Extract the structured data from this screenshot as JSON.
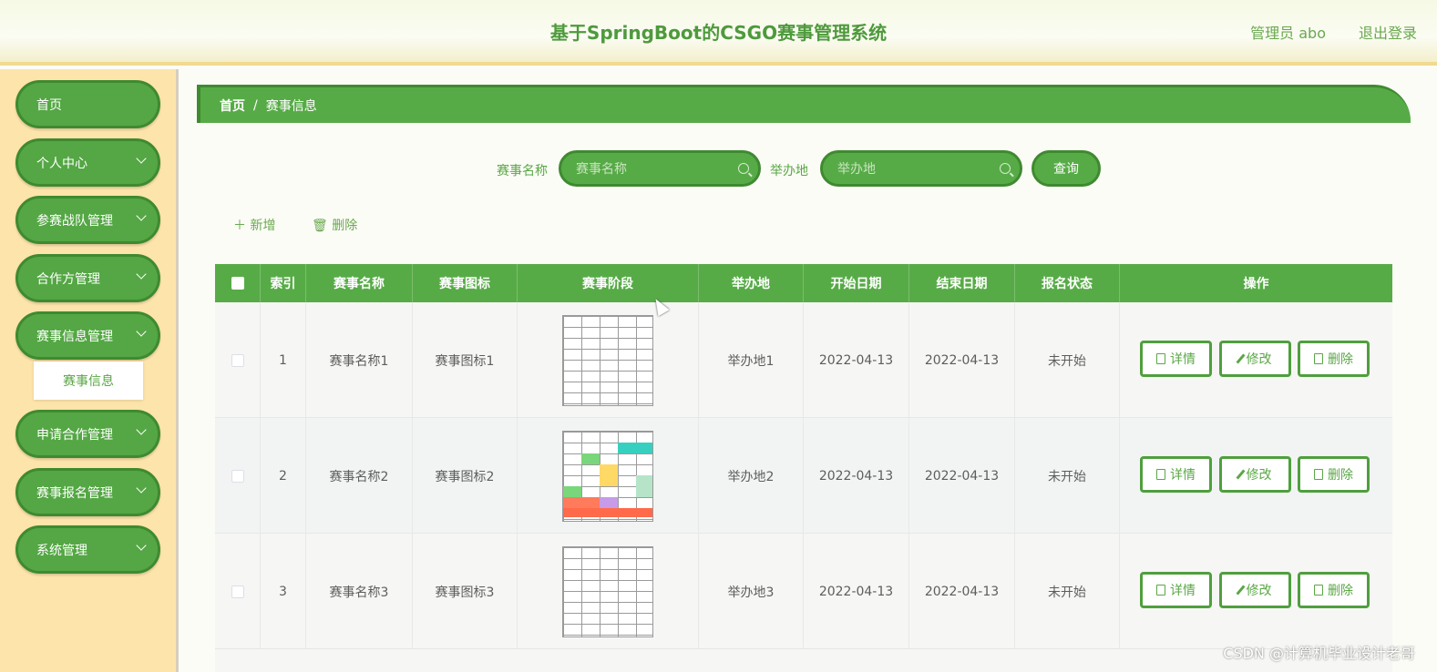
{
  "header": {
    "title": "基于SpringBoot的CSGO赛事管理系统",
    "user": "管理员 abo",
    "logout": "退出登录"
  },
  "sidebar": {
    "items": [
      {
        "label": "首页",
        "has_children": false
      },
      {
        "label": "个人中心",
        "has_children": true
      },
      {
        "label": "参赛战队管理",
        "has_children": true
      },
      {
        "label": "合作方管理",
        "has_children": true
      },
      {
        "label": "赛事信息管理",
        "has_children": true
      },
      {
        "label": "申请合作管理",
        "has_children": true
      },
      {
        "label": "赛事报名管理",
        "has_children": true
      },
      {
        "label": "系统管理",
        "has_children": true
      }
    ],
    "active_submenu": "赛事信息"
  },
  "breadcrumb": {
    "home": "首页",
    "separator": "/",
    "current": "赛事信息"
  },
  "search": {
    "name_label": "赛事名称",
    "name_placeholder": "赛事名称",
    "location_label": "举办地",
    "location_placeholder": "举办地",
    "query_button": "查询"
  },
  "actions": {
    "add": "新增",
    "delete": "删除"
  },
  "table": {
    "columns": [
      "",
      "索引",
      "赛事名称",
      "赛事图标",
      "赛事阶段",
      "举办地",
      "开始日期",
      "结束日期",
      "报名状态",
      "操作"
    ],
    "rows": [
      {
        "index": "1",
        "name": "赛事名称1",
        "icon": "赛事图标1",
        "location": "举办地1",
        "start": "2022-04-13",
        "end": "2022-04-13",
        "status": "未开始"
      },
      {
        "index": "2",
        "name": "赛事名称2",
        "icon": "赛事图标2",
        "location": "举办地2",
        "start": "2022-04-13",
        "end": "2022-04-13",
        "status": "未开始"
      },
      {
        "index": "3",
        "name": "赛事名称3",
        "icon": "赛事图标3",
        "location": "举办地3",
        "start": "2022-04-13",
        "end": "2022-04-13",
        "status": "未开始"
      }
    ],
    "row_buttons": {
      "detail": "详情",
      "edit": "修改",
      "delete": "删除"
    }
  },
  "watermark": "CSDN @计算机毕业设计老哥",
  "colors": {
    "primary": "#57ab47",
    "primary_border": "#3f8a30",
    "sidebar_bg": "#fde4aa",
    "title": "#4e9a3c"
  }
}
